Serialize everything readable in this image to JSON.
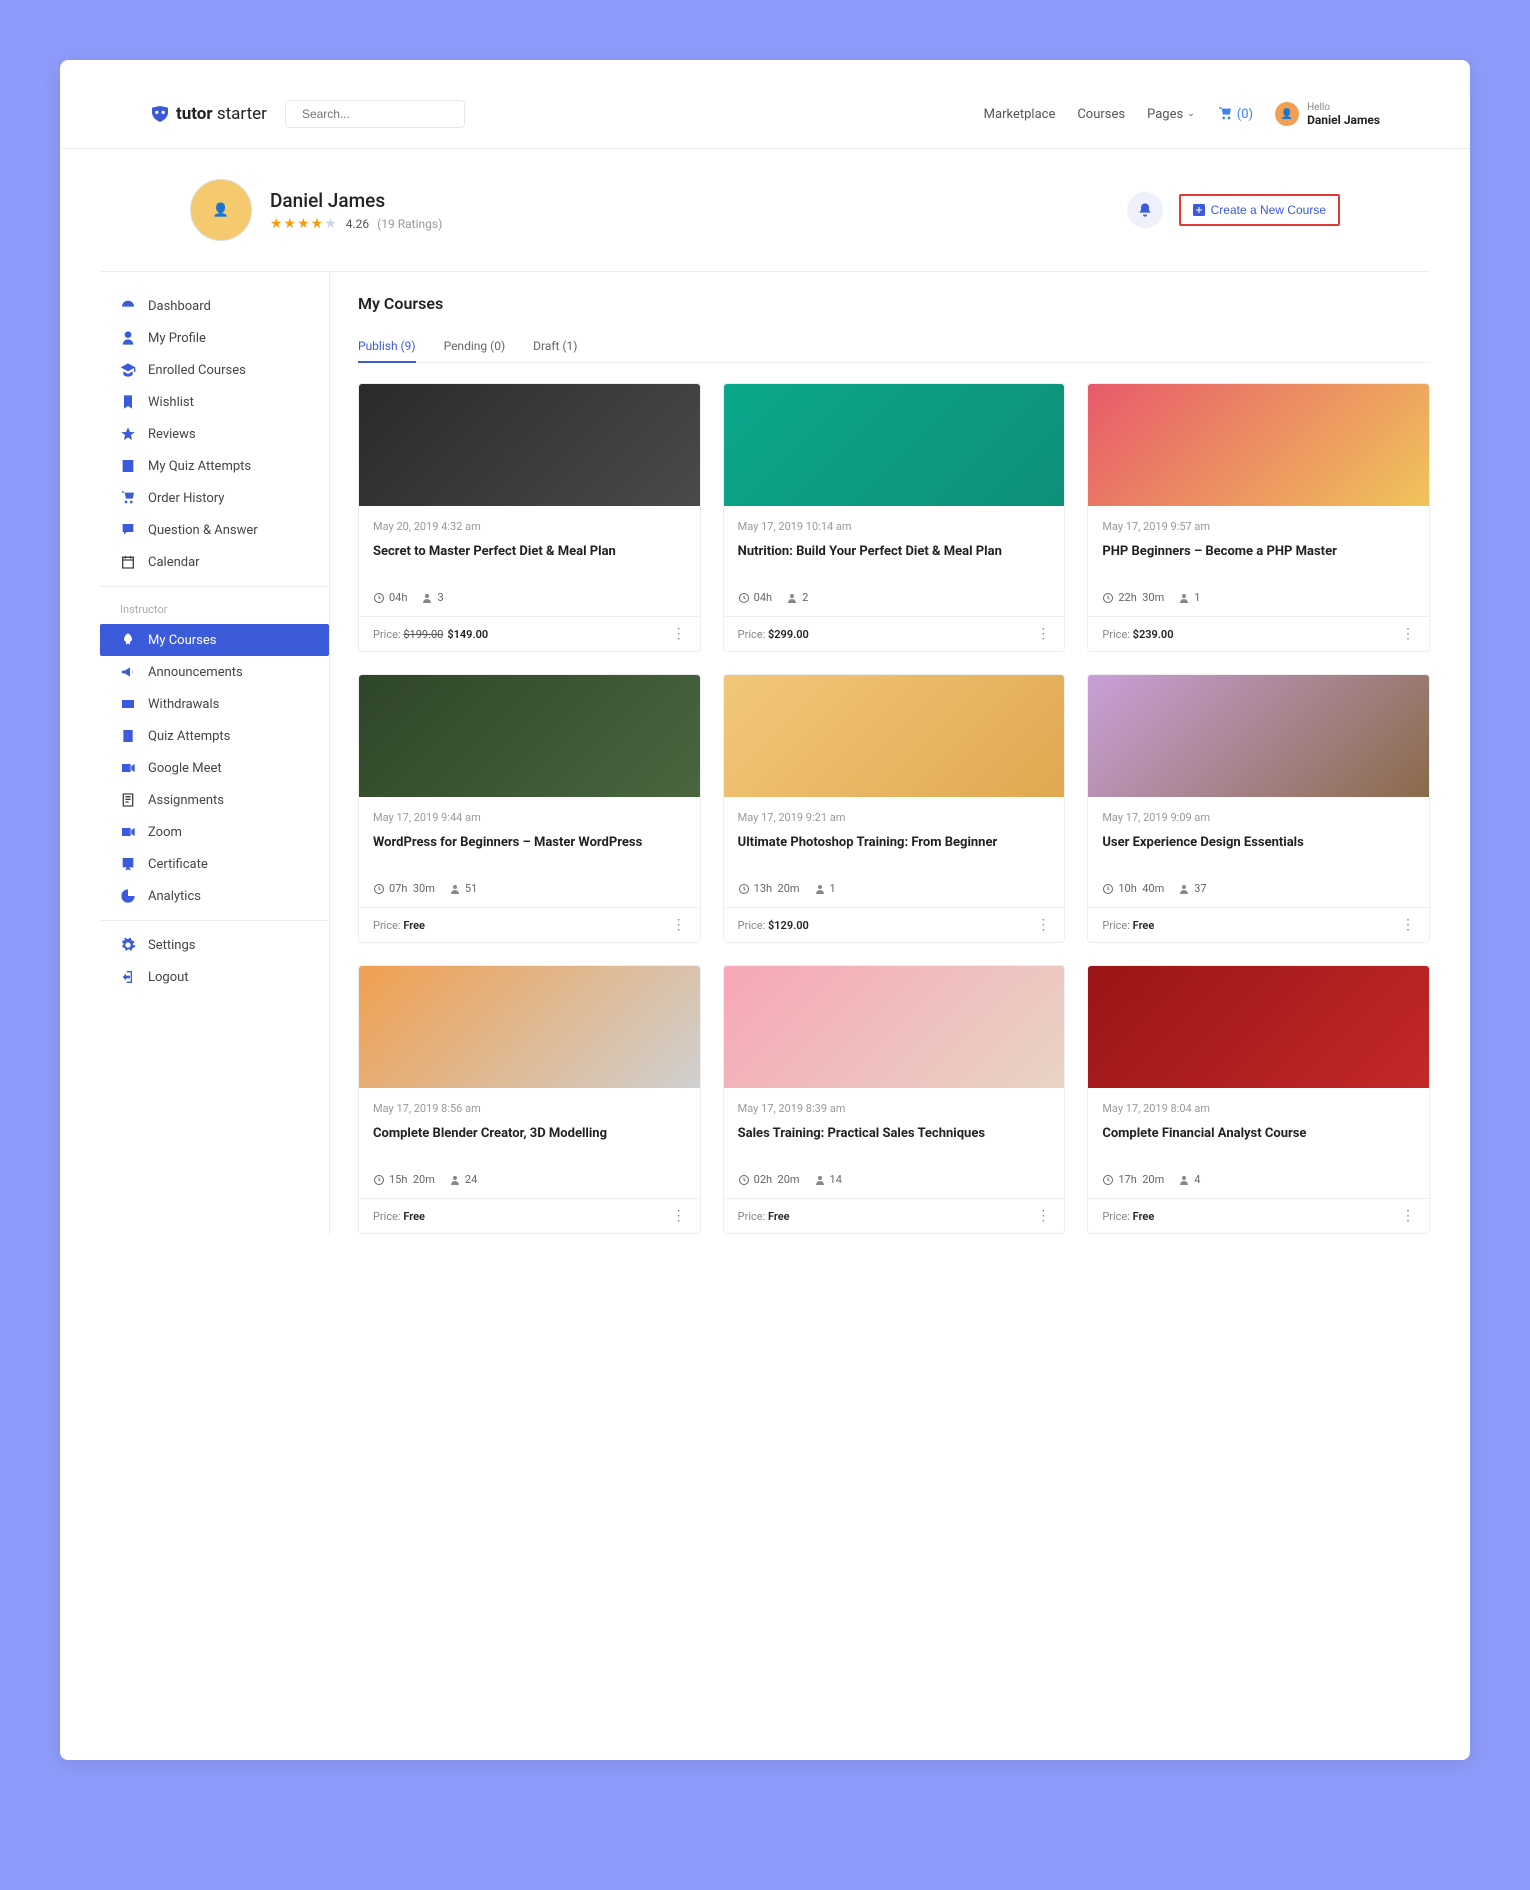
{
  "brand": {
    "name": "tutor",
    "suffix": "starter"
  },
  "search": {
    "placeholder": "Search..."
  },
  "nav": {
    "marketplace": "Marketplace",
    "courses": "Courses",
    "pages": "Pages",
    "cart_count": "(0)"
  },
  "user_chip": {
    "hello": "Hello",
    "name": "Daniel James"
  },
  "profile": {
    "name": "Daniel James",
    "rating": "4.26",
    "rating_count": "(19 Ratings)"
  },
  "actions": {
    "create": "Create a New Course"
  },
  "sidebar": {
    "student": [
      {
        "label": "Dashboard",
        "icon": "dashboard"
      },
      {
        "label": "My Profile",
        "icon": "user"
      },
      {
        "label": "Enrolled Courses",
        "icon": "grad"
      },
      {
        "label": "Wishlist",
        "icon": "bookmark"
      },
      {
        "label": "Reviews",
        "icon": "star"
      },
      {
        "label": "My Quiz Attempts",
        "icon": "quiz"
      },
      {
        "label": "Order History",
        "icon": "cart"
      },
      {
        "label": "Question & Answer",
        "icon": "qa"
      },
      {
        "label": "Calendar",
        "icon": "calendar"
      }
    ],
    "instructor_label": "Instructor",
    "instructor": [
      {
        "label": "My Courses",
        "icon": "rocket",
        "active": true
      },
      {
        "label": "Announcements",
        "icon": "megaphone"
      },
      {
        "label": "Withdrawals",
        "icon": "wallet"
      },
      {
        "label": "Quiz Attempts",
        "icon": "quiz2"
      },
      {
        "label": "Google Meet",
        "icon": "video"
      },
      {
        "label": "Assignments",
        "icon": "assign"
      },
      {
        "label": "Zoom",
        "icon": "video2"
      },
      {
        "label": "Certificate",
        "icon": "cert"
      },
      {
        "label": "Analytics",
        "icon": "chart"
      }
    ],
    "footer": [
      {
        "label": "Settings",
        "icon": "gear"
      },
      {
        "label": "Logout",
        "icon": "logout"
      }
    ]
  },
  "section": {
    "title": "My Courses"
  },
  "tabs": [
    {
      "label": "Publish (9)",
      "active": true
    },
    {
      "label": "Pending (0)"
    },
    {
      "label": "Draft (1)"
    }
  ],
  "price_label": "Price:",
  "courses": [
    {
      "thumb": "thumb-1",
      "date": "May 20, 2019 4:32 am",
      "title": "Secret to Master Perfect Diet & Meal Plan",
      "duration": "04h",
      "students": "3",
      "price": "$149.00",
      "strike": "$199.00"
    },
    {
      "thumb": "thumb-2",
      "date": "May 17, 2019 10:14 am",
      "title": "Nutrition: Build Your Perfect Diet & Meal Plan",
      "duration": "04h",
      "students": "2",
      "price": "$299.00"
    },
    {
      "thumb": "thumb-3",
      "date": "May 17, 2019 9:57 am",
      "title": "PHP Beginners – Become a PHP Master",
      "duration": "22h 30m",
      "students": "1",
      "price": "$239.00"
    },
    {
      "thumb": "thumb-4",
      "date": "May 17, 2019 9:44 am",
      "title": "WordPress for Beginners – Master WordPress",
      "duration": "07h 30m",
      "students": "51",
      "price": "Free"
    },
    {
      "thumb": "thumb-5",
      "date": "May 17, 2019 9:21 am",
      "title": "Ultimate Photoshop Training: From Beginner",
      "duration": "13h 20m",
      "students": "1",
      "price": "$129.00"
    },
    {
      "thumb": "thumb-6",
      "date": "May 17, 2019 9:09 am",
      "title": "User Experience Design Essentials",
      "duration": "10h 40m",
      "students": "37",
      "price": "Free"
    },
    {
      "thumb": "thumb-7",
      "date": "May 17, 2019 8:56 am",
      "title": "Complete Blender Creator, 3D Modelling",
      "duration": "15h 20m",
      "students": "24",
      "price": "Free"
    },
    {
      "thumb": "thumb-8",
      "date": "May 17, 2019 8:39 am",
      "title": "Sales Training: Practical Sales Techniques",
      "duration": "02h 20m",
      "students": "14",
      "price": "Free"
    },
    {
      "thumb": "thumb-9",
      "date": "May 17, 2019 8:04 am",
      "title": "Complete Financial Analyst Course",
      "duration": "17h 20m",
      "students": "4",
      "price": "Free"
    }
  ]
}
